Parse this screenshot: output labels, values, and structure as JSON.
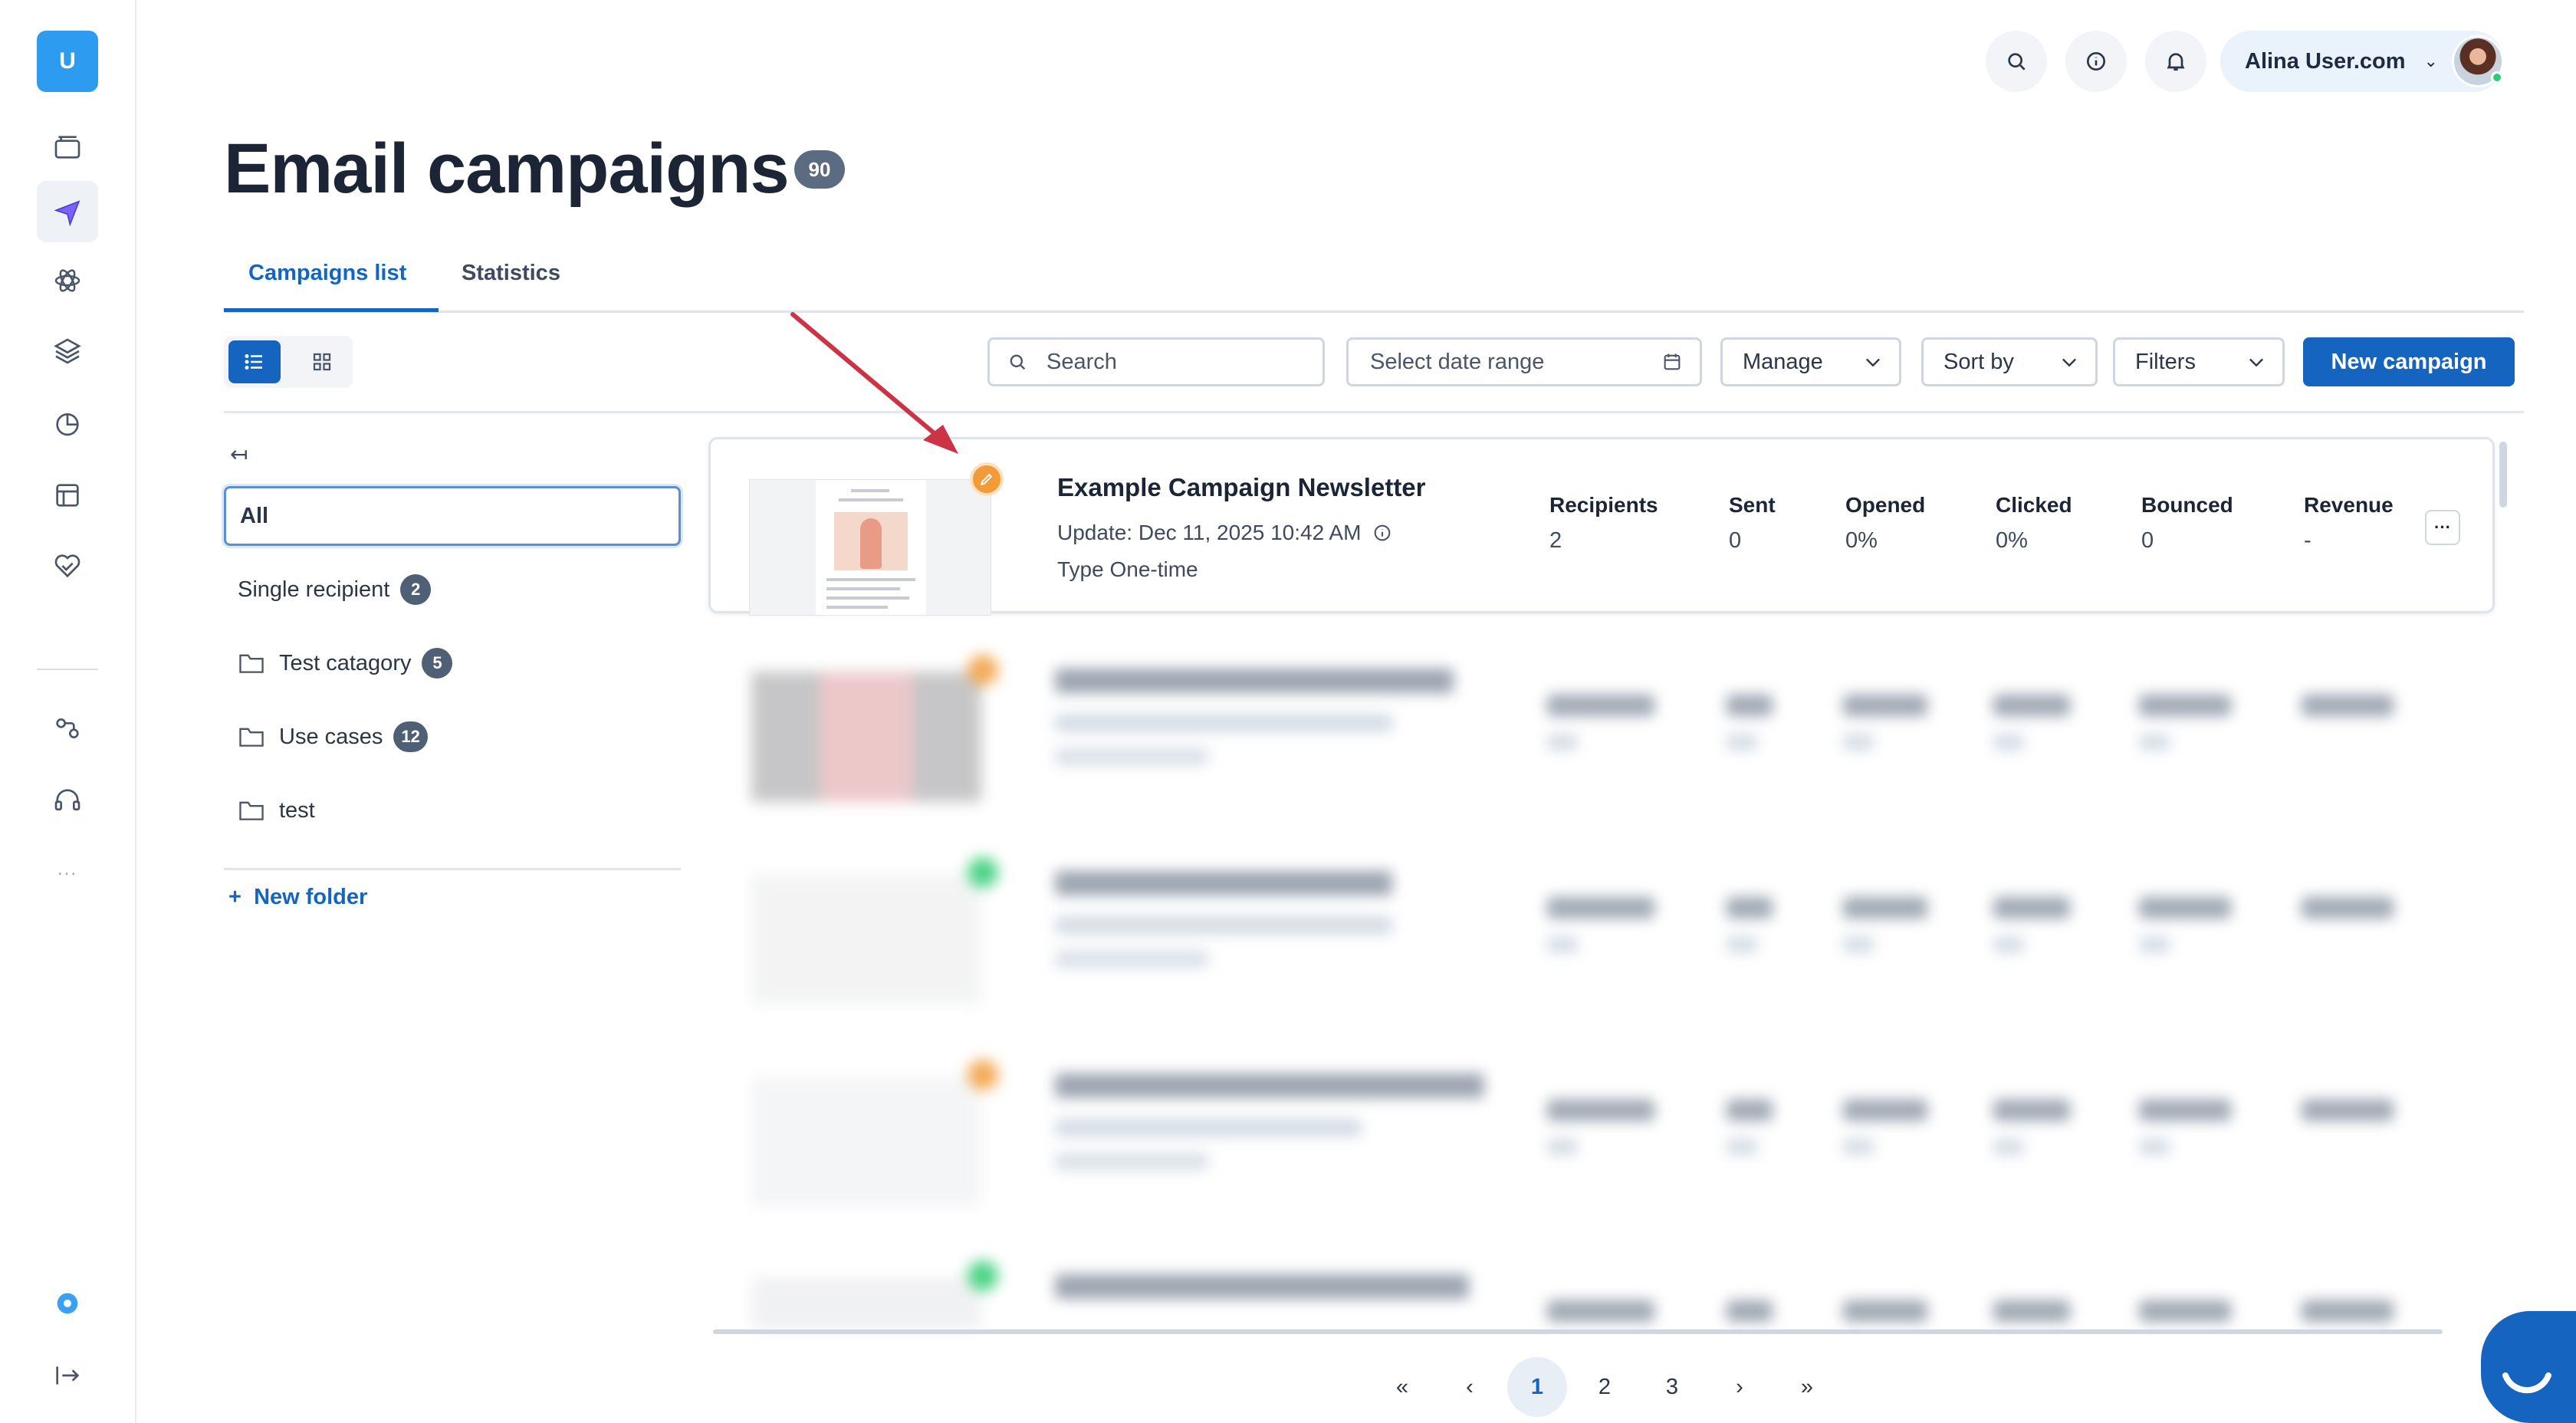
{
  "rail": {
    "logo_letter": "U",
    "more": "...",
    "items": [
      {
        "icon": "archive-icon"
      },
      {
        "icon": "send-icon",
        "active": true
      },
      {
        "icon": "atom-icon"
      },
      {
        "icon": "layers-icon"
      },
      {
        "icon": "pie-chart-icon"
      },
      {
        "icon": "window-icon"
      },
      {
        "icon": "handshake-icon"
      },
      {
        "icon": "workflow-icon"
      },
      {
        "icon": "headset-icon"
      },
      {
        "icon": "help-icon"
      },
      {
        "icon": "logout-icon"
      }
    ]
  },
  "topbar": {
    "user_name": "Alina User.com",
    "icons": [
      "search-icon",
      "info-icon",
      "bell-icon"
    ]
  },
  "page": {
    "title": "Email campaigns",
    "count": "90"
  },
  "tabs": [
    {
      "label": "Campaigns list",
      "active": true
    },
    {
      "label": "Statistics",
      "active": false
    }
  ],
  "toolbar": {
    "search_placeholder": "Search",
    "date_placeholder": "Select date range",
    "manage_label": "Manage",
    "sort_label": "Sort by",
    "filters_label": "Filters",
    "new_campaign_label": "New campaign"
  },
  "folders": {
    "collapse_glyph": "↤",
    "all_label": "All",
    "items": [
      {
        "label": "Single recipient",
        "count": "2",
        "folder": false
      },
      {
        "label": "Test catagory",
        "count": "5",
        "folder": true
      },
      {
        "label": "Use cases",
        "count": "12",
        "folder": true
      },
      {
        "label": "test",
        "count": "",
        "folder": true
      }
    ],
    "new_folder_label": "New folder"
  },
  "campaign": {
    "name": "Example Campaign Newsletter",
    "update": "Update: Dec 11, 2025 10:42 AM",
    "type": "Type One-time",
    "status_color": "#f29b38",
    "stats": [
      {
        "label": "Recipients",
        "value": "2"
      },
      {
        "label": "Sent",
        "value": "0"
      },
      {
        "label": "Opened",
        "value": "0%"
      },
      {
        "label": "Clicked",
        "value": "0%"
      },
      {
        "label": "Bounced",
        "value": "0"
      },
      {
        "label": "Revenue",
        "value": "-"
      }
    ],
    "more_label": "···"
  },
  "blurred_rows": [
    {
      "status_color": "#f29b38"
    },
    {
      "status_color": "#2ecc71"
    },
    {
      "status_color": "#f29b38"
    },
    {
      "status_color": "#2ecc71"
    }
  ],
  "pagination": {
    "first": "«",
    "prev": "‹",
    "pages": [
      "1",
      "2",
      "3"
    ],
    "current": "1",
    "next": "›",
    "last": "»"
  },
  "colors": {
    "accent": "#1565c0",
    "annotation_arrow": "#cc3344"
  }
}
